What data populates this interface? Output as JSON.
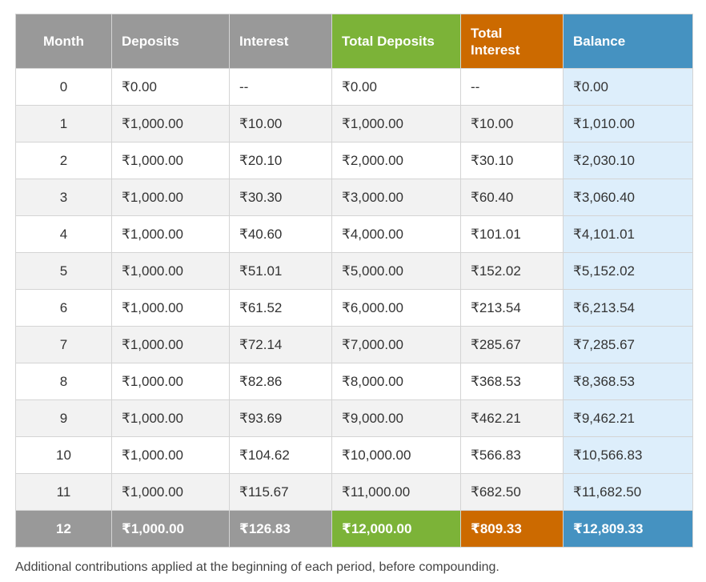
{
  "headers": [
    {
      "label": "Month",
      "color": "#999999"
    },
    {
      "label": "Deposits",
      "color": "#999999"
    },
    {
      "label": "Interest",
      "color": "#999999"
    },
    {
      "label": "Total Deposits",
      "color": "#7cb338"
    },
    {
      "label": "Total Interest",
      "color": "#cc6a00"
    },
    {
      "label": "Balance",
      "color": "#4592c1"
    }
  ],
  "rows": [
    [
      "0",
      "₹0.00",
      "--",
      "₹0.00",
      "--",
      "₹0.00"
    ],
    [
      "1",
      "₹1,000.00",
      "₹10.00",
      "₹1,000.00",
      "₹10.00",
      "₹1,010.00"
    ],
    [
      "2",
      "₹1,000.00",
      "₹20.10",
      "₹2,000.00",
      "₹30.10",
      "₹2,030.10"
    ],
    [
      "3",
      "₹1,000.00",
      "₹30.30",
      "₹3,000.00",
      "₹60.40",
      "₹3,060.40"
    ],
    [
      "4",
      "₹1,000.00",
      "₹40.60",
      "₹4,000.00",
      "₹101.01",
      "₹4,101.01"
    ],
    [
      "5",
      "₹1,000.00",
      "₹51.01",
      "₹5,000.00",
      "₹152.02",
      "₹5,152.02"
    ],
    [
      "6",
      "₹1,000.00",
      "₹61.52",
      "₹6,000.00",
      "₹213.54",
      "₹6,213.54"
    ],
    [
      "7",
      "₹1,000.00",
      "₹72.14",
      "₹7,000.00",
      "₹285.67",
      "₹7,285.67"
    ],
    [
      "8",
      "₹1,000.00",
      "₹82.86",
      "₹8,000.00",
      "₹368.53",
      "₹8,368.53"
    ],
    [
      "9",
      "₹1,000.00",
      "₹93.69",
      "₹9,000.00",
      "₹462.21",
      "₹9,462.21"
    ],
    [
      "10",
      "₹1,000.00",
      "₹104.62",
      "₹10,000.00",
      "₹566.83",
      "₹10,566.83"
    ],
    [
      "11",
      "₹1,000.00",
      "₹115.67",
      "₹11,000.00",
      "₹682.50",
      "₹11,682.50"
    ]
  ],
  "final_row": [
    "12",
    "₹1,000.00",
    "₹126.83",
    "₹12,000.00",
    "₹809.33",
    "₹12,809.33"
  ],
  "balance_cell_bg": "#ddeefb",
  "note": "Additional contributions applied at the beginning of each period, before compounding."
}
